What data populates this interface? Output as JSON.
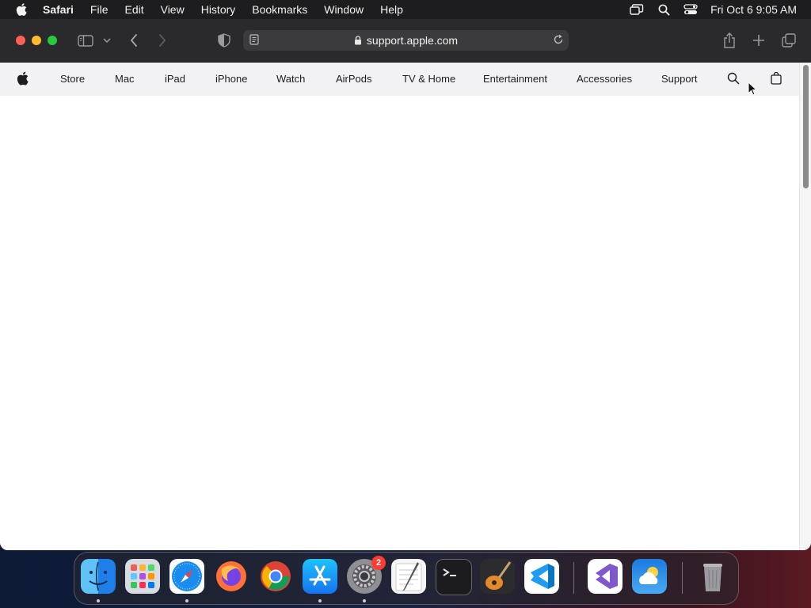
{
  "menubar": {
    "app_name": "Safari",
    "items": [
      "File",
      "Edit",
      "View",
      "History",
      "Bookmarks",
      "Window",
      "Help"
    ],
    "clock": "Fri Oct 6  9:05 AM"
  },
  "browser": {
    "url": "support.apple.com"
  },
  "apple_nav": {
    "items": [
      "Store",
      "Mac",
      "iPad",
      "iPhone",
      "Watch",
      "AirPods",
      "TV & Home",
      "Entertainment",
      "Accessories",
      "Support"
    ]
  },
  "dock": {
    "apps": [
      "Finder",
      "Launchpad",
      "Safari",
      "Firefox",
      "Chrome",
      "App Store",
      "System Settings",
      "TextEdit",
      "Terminal",
      "GarageBand",
      "Visual Studio Code",
      "Visual Studio",
      "Weather",
      "Trash"
    ],
    "settings_badge": "2"
  },
  "colors": {
    "menubar_bg": "#1d1d1f",
    "toolbar_bg": "#2a2a2c",
    "nav_bg": "#f2f2f4",
    "badge": "#ff3b30"
  }
}
